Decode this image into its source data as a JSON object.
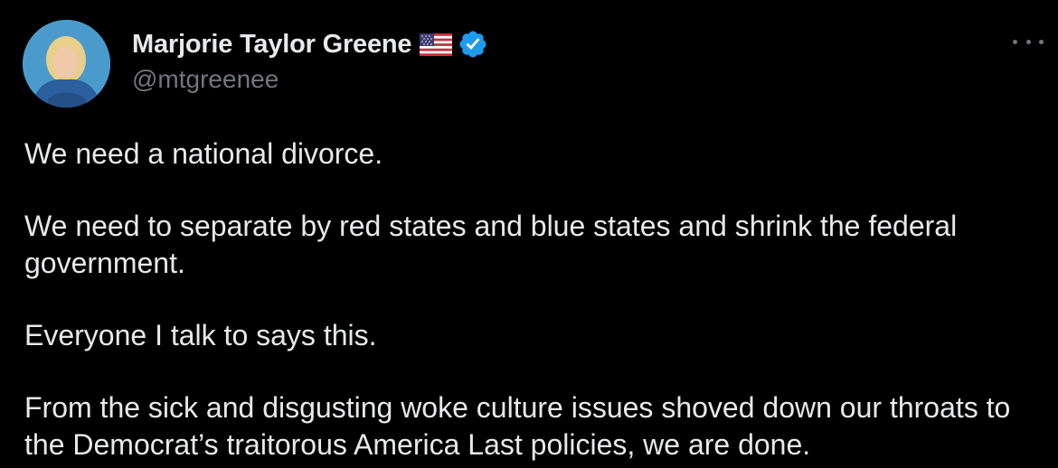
{
  "author": {
    "display_name": "Marjorie Taylor Greene",
    "handle": "@mtgreenee",
    "badges": [
      "us-flag-icon",
      "verified-badge-icon"
    ]
  },
  "colors": {
    "background": "#000000",
    "text_primary": "#e7e9ea",
    "text_secondary": "#71767b",
    "verified_blue": "#1d9bf0"
  },
  "tweet": {
    "paragraphs": [
      "We need a national divorce.",
      "We need to separate by red states and blue states and shrink the federal government.",
      "Everyone I talk to says this.",
      "From the sick and disgusting woke culture issues shoved down our throats to the Democrat’s traitorous America Last policies, we are done."
    ]
  },
  "icons": {
    "more": "more-options-icon"
  }
}
